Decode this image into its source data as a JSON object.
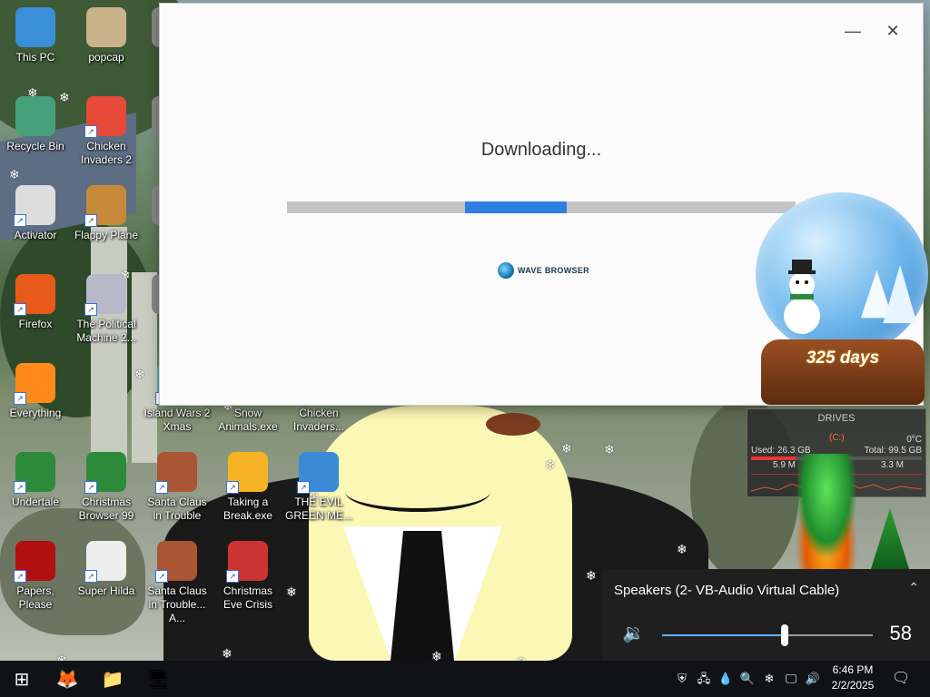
{
  "desktop": {
    "icons": [
      {
        "label": "This PC",
        "icon": "monitor-icon"
      },
      {
        "label": "popcap",
        "icon": "folder-icon"
      },
      {
        "label": "Th",
        "icon": "app-icon"
      },
      {
        "label": "Recycle Bin",
        "icon": "recycle-bin-icon"
      },
      {
        "label": "Chicken Invaders 2",
        "icon": "chicken-icon"
      },
      {
        "label": "Ar S",
        "icon": "app-icon"
      },
      {
        "label": "Activator",
        "icon": "activator-icon"
      },
      {
        "label": "Flappy Plane",
        "icon": "game-icon"
      },
      {
        "label": "m",
        "icon": "app-icon"
      },
      {
        "label": "Firefox",
        "icon": "firefox-icon"
      },
      {
        "label": "The Political Machine 2...",
        "icon": "political-machine-icon"
      },
      {
        "label": "un",
        "icon": "app-icon"
      },
      {
        "label": "Everything",
        "icon": "search-icon"
      },
      {
        "label": "Island Wars 2 Xmas",
        "icon": "game-icon"
      },
      {
        "label": "Snow Animals.exe",
        "icon": "game-icon"
      },
      {
        "label": "Chicken Invaders...",
        "icon": "chicken-icon"
      },
      {
        "label": "Undertale",
        "icon": "undertale-icon"
      },
      {
        "label": "Christmas Browser 99",
        "icon": "christmas-tree-icon"
      },
      {
        "label": "Santa Claus in Trouble",
        "icon": "santa-icon"
      },
      {
        "label": "Taking a Break.exe",
        "icon": "star-icon"
      },
      {
        "label": "THE EVIL GREEN ME...",
        "icon": "people-icon"
      },
      {
        "label": "Papers, Please",
        "icon": "papers-please-icon"
      },
      {
        "label": "Super Hilda",
        "icon": "pixel-icon"
      },
      {
        "label": "Santa Claus in Trouble... A...",
        "icon": "santa-icon"
      },
      {
        "label": "Christmas Eve Crisis",
        "icon": "santa-icon"
      }
    ]
  },
  "installer": {
    "status": "Downloading...",
    "progress": {
      "start": 0.35,
      "end": 0.55
    },
    "brand": "WAVE BROWSER",
    "minimize_glyph": "—",
    "close_glyph": "✕"
  },
  "snowglobe": {
    "days_label": "325 days"
  },
  "drives": {
    "title": "DRIVES",
    "drive": "(C:)",
    "temp": "0°C",
    "used": "Used: 26.3 GB",
    "total": "Total: 99.5 GB",
    "read": "5.9 M",
    "write": "3.3 M",
    "used_fraction": 0.26
  },
  "volume": {
    "device": "Speakers (2- VB-Audio Virtual Cable)",
    "level": 58,
    "level_text": "58",
    "expand_glyph": "⌃",
    "speaker_glyph": "🔉"
  },
  "taskbar": {
    "time": "6:46 PM",
    "date": "2/2/2025",
    "start_glyph": "⊞",
    "pinned": [
      {
        "icon": "firefox-icon",
        "glyph": "🦊"
      },
      {
        "icon": "file-explorer-icon",
        "glyph": "📁"
      },
      {
        "icon": "app-icon",
        "glyph": "🖥"
      }
    ],
    "tray": [
      {
        "icon": "security-icon",
        "glyph": "⛨"
      },
      {
        "icon": "network-app-icon",
        "glyph": "🖧"
      },
      {
        "icon": "drop-icon",
        "glyph": "💧"
      },
      {
        "icon": "search-icon",
        "glyph": "🔍"
      },
      {
        "icon": "snowflake-icon",
        "glyph": "❄"
      },
      {
        "icon": "network-icon",
        "glyph": "🖵"
      },
      {
        "icon": "volume-icon",
        "glyph": "🔊"
      }
    ],
    "notification_glyph": "🗨"
  }
}
